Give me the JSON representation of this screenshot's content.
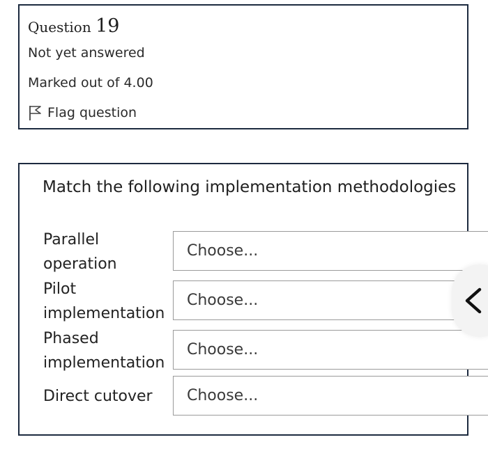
{
  "question_info": {
    "title_prefix": "Question",
    "number": "19",
    "status": "Not yet answered",
    "marks": "Marked out of 4.00",
    "flag_label": "Flag question"
  },
  "question": {
    "prompt": "Match the following implementation methodologies",
    "rows": [
      {
        "label_line1": "Parallel",
        "label_line2": "operation",
        "select_value": "Choose..."
      },
      {
        "label_line1": "Pilot",
        "label_line2": "implementation",
        "select_value": "Choose..."
      },
      {
        "label_line1": "Phased",
        "label_line2": "implementation",
        "select_value": "Choose..."
      },
      {
        "label_line1": "Direct cutover",
        "select_value": "Choose..."
      }
    ]
  },
  "icons": {
    "flag": "flag-icon",
    "back": "chevron-left-icon"
  }
}
